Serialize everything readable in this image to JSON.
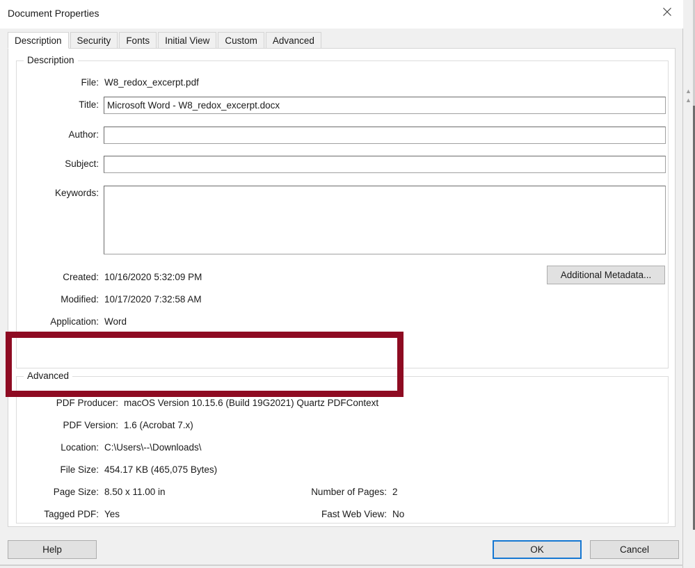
{
  "window": {
    "title": "Document Properties",
    "close_icon": "close-icon"
  },
  "tabs": [
    {
      "label": "Description",
      "active": true
    },
    {
      "label": "Security",
      "active": false
    },
    {
      "label": "Fonts",
      "active": false
    },
    {
      "label": "Initial View",
      "active": false
    },
    {
      "label": "Custom",
      "active": false
    },
    {
      "label": "Advanced",
      "active": false
    }
  ],
  "description_group": {
    "legend": "Description",
    "file": {
      "label": "File:",
      "value": "W8_redox_excerpt.pdf"
    },
    "title": {
      "label": "Title:",
      "value": "Microsoft Word - W8_redox_excerpt.docx",
      "placeholder": ""
    },
    "author": {
      "label": "Author:",
      "value": "",
      "placeholder": ""
    },
    "subject": {
      "label": "Subject:",
      "value": "",
      "placeholder": ""
    },
    "keywords": {
      "label": "Keywords:",
      "value": "",
      "placeholder": ""
    },
    "created": {
      "label": "Created:",
      "value": "10/16/2020 5:32:09 PM"
    },
    "modified": {
      "label": "Modified:",
      "value": "10/17/2020 7:32:58 AM"
    },
    "application": {
      "label": "Application:",
      "value": "Word"
    },
    "additional_metadata_button": "Additional Metadata..."
  },
  "advanced_group": {
    "legend": "Advanced",
    "pdf_producer": {
      "label": "PDF Producer:",
      "value": "macOS Version 10.15.6 (Build 19G2021) Quartz PDFContext"
    },
    "pdf_version": {
      "label": "PDF Version:",
      "value": "1.6 (Acrobat 7.x)"
    },
    "location": {
      "label": "Location:",
      "value": "C:\\Users\\--\\Downloads\\"
    },
    "file_size": {
      "label": "File Size:",
      "value": "454.17 KB (465,075 Bytes)"
    },
    "page_size": {
      "label": "Page Size:",
      "value": "8.50 x 11.00 in"
    },
    "number_of_pages": {
      "label": "Number of Pages:",
      "value": "2"
    },
    "tagged_pdf": {
      "label": "Tagged PDF:",
      "value": "Yes"
    },
    "fast_web_view": {
      "label": "Fast Web View:",
      "value": "No"
    }
  },
  "footer": {
    "help": "Help",
    "ok": "OK",
    "cancel": "Cancel"
  },
  "annotation": {
    "highlight_color": "#8e0b22",
    "focus_color": "#1577d2"
  }
}
